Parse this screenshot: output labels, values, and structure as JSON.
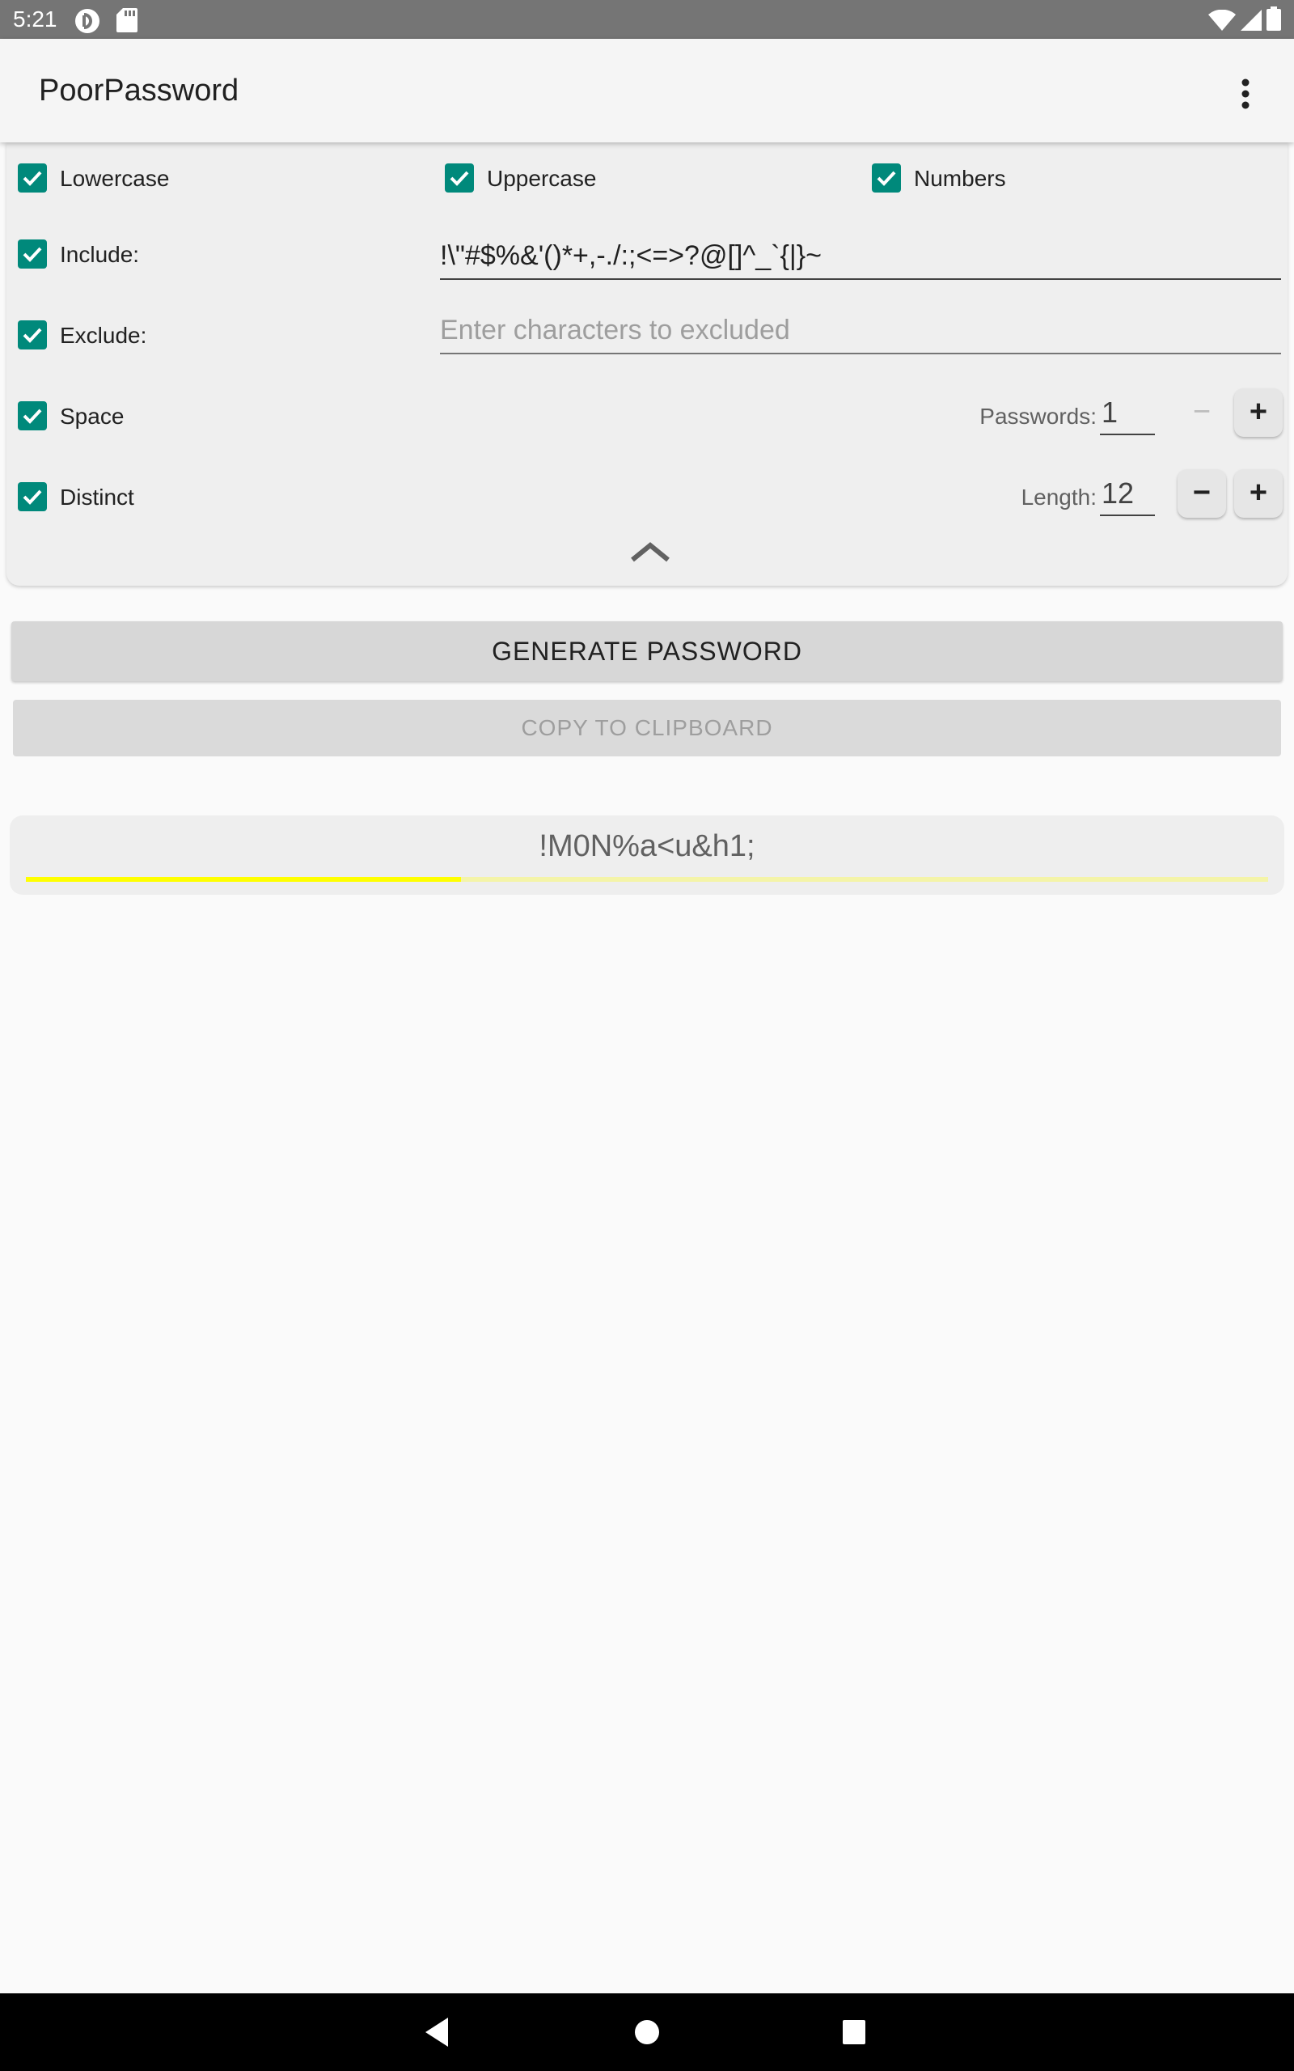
{
  "status_bar": {
    "time": "5:21",
    "left_icons": [
      "pocket-casts-icon",
      "sd-card-icon"
    ],
    "right_icons": [
      "wifi-icon",
      "cell-signal-icon",
      "battery-icon"
    ]
  },
  "app_bar": {
    "title": "PoorPassword",
    "menu_icon": "more-vert-icon"
  },
  "options": {
    "lowercase": {
      "label": "Lowercase",
      "checked": true
    },
    "uppercase": {
      "label": "Uppercase",
      "checked": true
    },
    "numbers": {
      "label": "Numbers",
      "checked": true
    },
    "include": {
      "label": "Include:",
      "checked": true,
      "value": "!\\\"#$%&'()*+,-./:;<=>?@[]^_`{|}~"
    },
    "exclude": {
      "label": "Exclude:",
      "checked": true,
      "value": "",
      "placeholder": "Enter characters to excluded"
    },
    "space": {
      "label": "Space",
      "checked": true
    },
    "distinct": {
      "label": "Distinct",
      "checked": true
    },
    "passwords": {
      "label": "Passwords:",
      "value": "1",
      "minus": "−",
      "plus": "+"
    },
    "length": {
      "label": "Length:",
      "value": "12",
      "minus": "−",
      "plus": "+"
    },
    "collapse_icon": "chevron-up-icon"
  },
  "actions": {
    "generate_label": "GENERATE PASSWORD",
    "copy_label": "COPY TO CLIPBOARD"
  },
  "result": {
    "password": "!M0N%a<u&h1;",
    "strength_fraction": 0.35,
    "strength_color": "#ffff00"
  },
  "colors": {
    "checkbox_accent": "#00897b",
    "status_bar": "#757575",
    "nav_bar": "#000000"
  },
  "nav_bar": {
    "icons": [
      "back-icon",
      "home-icon",
      "recents-icon"
    ]
  }
}
